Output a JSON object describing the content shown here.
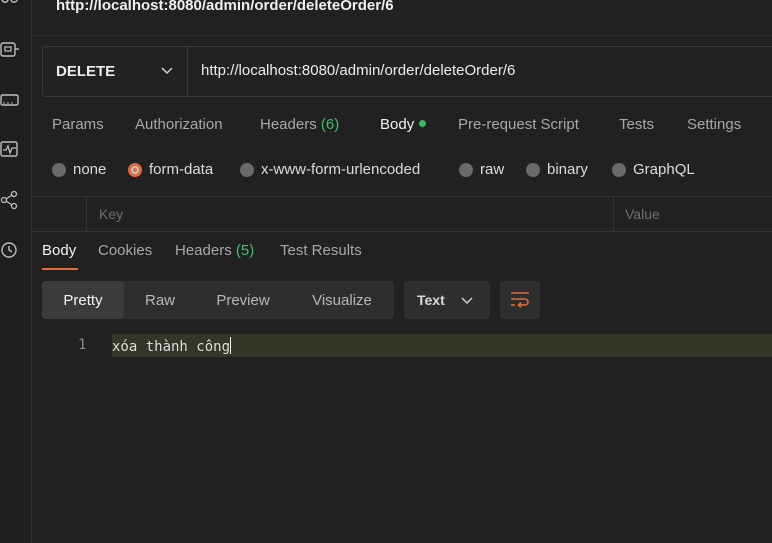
{
  "request": {
    "title": "http://localhost:8080/admin/order/deleteOrder/6",
    "method": "DELETE",
    "url": "http://localhost:8080/admin/order/deleteOrder/6"
  },
  "request_tabs": {
    "params": "Params",
    "authorization": "Authorization",
    "headers_label": "Headers",
    "headers_count": "(6)",
    "body": "Body",
    "pre_request_script": "Pre-request Script",
    "tests": "Tests",
    "settings": "Settings"
  },
  "body_types": {
    "none": "none",
    "form_data": "form-data",
    "urlencoded": "x-www-form-urlencoded",
    "raw": "raw",
    "binary": "binary",
    "graphql": "GraphQL",
    "selected": "form-data"
  },
  "params_table": {
    "key_header": "Key",
    "value_header": "Value"
  },
  "response_tabs": {
    "body": "Body",
    "cookies": "Cookies",
    "headers_label": "Headers",
    "headers_count": "(5)",
    "test_results": "Test Results"
  },
  "response_view": {
    "pretty": "Pretty",
    "raw": "Raw",
    "preview": "Preview",
    "visualize": "Visualize",
    "format": "Text"
  },
  "response_body": {
    "line_number": "1",
    "text": "xóa thành công"
  },
  "colors": {
    "accent": "#e46a3c",
    "count_green": "#43c06e",
    "background": "#212121"
  }
}
